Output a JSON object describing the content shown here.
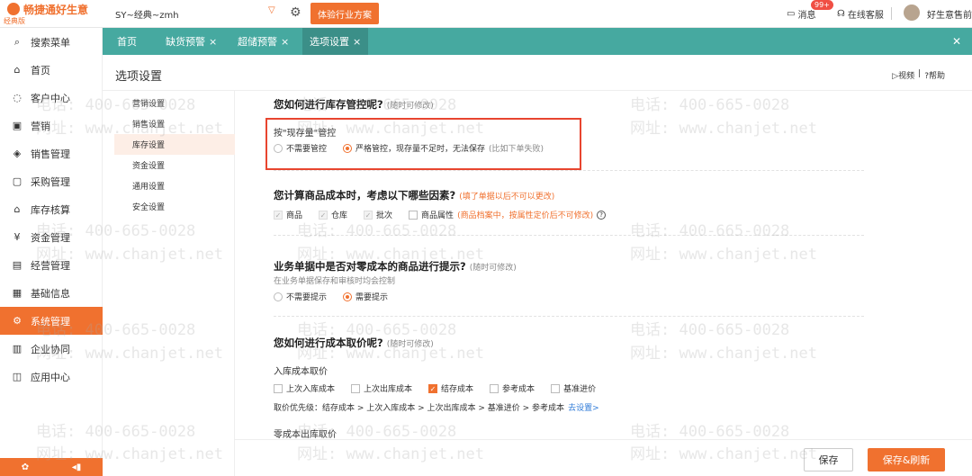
{
  "topbar": {
    "logo_name": "畅捷通好生意",
    "logo_sub": "经典版",
    "account": "SY~经典~zmh",
    "experience_btn": "体验行业方案",
    "messages": "消息",
    "messages_badge": "99+",
    "support": "在线客服",
    "user": "好生意售前"
  },
  "sidebar": {
    "items": [
      {
        "label": "搜索菜单",
        "icon": "search-icon"
      },
      {
        "label": "首页",
        "icon": "home-icon"
      },
      {
        "label": "客户中心",
        "icon": "customer-icon"
      },
      {
        "label": "营销",
        "icon": "gift-icon"
      },
      {
        "label": "销售管理",
        "icon": "sales-icon"
      },
      {
        "label": "采购管理",
        "icon": "purchase-icon"
      },
      {
        "label": "库存核算",
        "icon": "warehouse-icon"
      },
      {
        "label": "资金管理",
        "icon": "money-icon"
      },
      {
        "label": "经营管理",
        "icon": "clipboard-icon"
      },
      {
        "label": "基础信息",
        "icon": "info-icon"
      },
      {
        "label": "系统管理",
        "icon": "gear-icon"
      },
      {
        "label": "企业协同",
        "icon": "collab-icon"
      },
      {
        "label": "应用中心",
        "icon": "app-icon"
      }
    ]
  },
  "tabs": [
    {
      "label": "首页"
    },
    {
      "label": "缺货预警"
    },
    {
      "label": "超储预警"
    },
    {
      "label": "选项设置"
    }
  ],
  "page": {
    "title": "选项设置",
    "video": "视频",
    "help": "帮助"
  },
  "left_menu": [
    "营销设置",
    "销售设置",
    "库存设置",
    "资金设置",
    "通用设置",
    "安全设置"
  ],
  "content": {
    "s1_title": "您如何进行库存管控呢?",
    "s1_note": "(随时可修改)",
    "s1_sub": "按\"现存量\"管控",
    "s1_opt1": "不需要管控",
    "s1_opt2": "严格管控，现存量不足时，无法保存",
    "s1_opt2_note": "(比如下单失败)",
    "s2_title": "您计算商品成本时，考虑以下哪些因素?",
    "s2_note": "(填了单据以后不可以更改)",
    "s2_opts": [
      "商品",
      "仓库",
      "批次",
      "商品属性"
    ],
    "s2_attr_note": "(商品档案中，按属性定价后不可修改)",
    "s3_title": "业务单据中是否对零成本的商品进行提示?",
    "s3_note": "(随时可修改)",
    "s3_sub": "在业务单据保存和审核时均会控制",
    "s3_opt1": "不需要提示",
    "s3_opt2": "需要提示",
    "s4_title": "您如何进行成本取价呢?",
    "s4_note": "(随时可修改)",
    "s4_sub": "入库成本取价",
    "s4_opts": [
      "上次入库成本",
      "上次出库成本",
      "结存成本",
      "参考成本",
      "基准进价"
    ],
    "s4_priority": "取价优先级：结存成本 > 上次入库成本 > 上次出库成本 > 基准进价 > 参考成本",
    "s4_link": "去设置>",
    "s5_sub": "零成本出库取价"
  },
  "footer": {
    "save": "保存",
    "save_refresh": "保存&刷新"
  },
  "watermark": {
    "phone": "电话: 400-665-0028",
    "site": "网址: www.chanjet.net"
  },
  "colors": {
    "accent": "#f0712f",
    "tabbar": "#46a9a0",
    "highlight_border": "#e8452f"
  }
}
